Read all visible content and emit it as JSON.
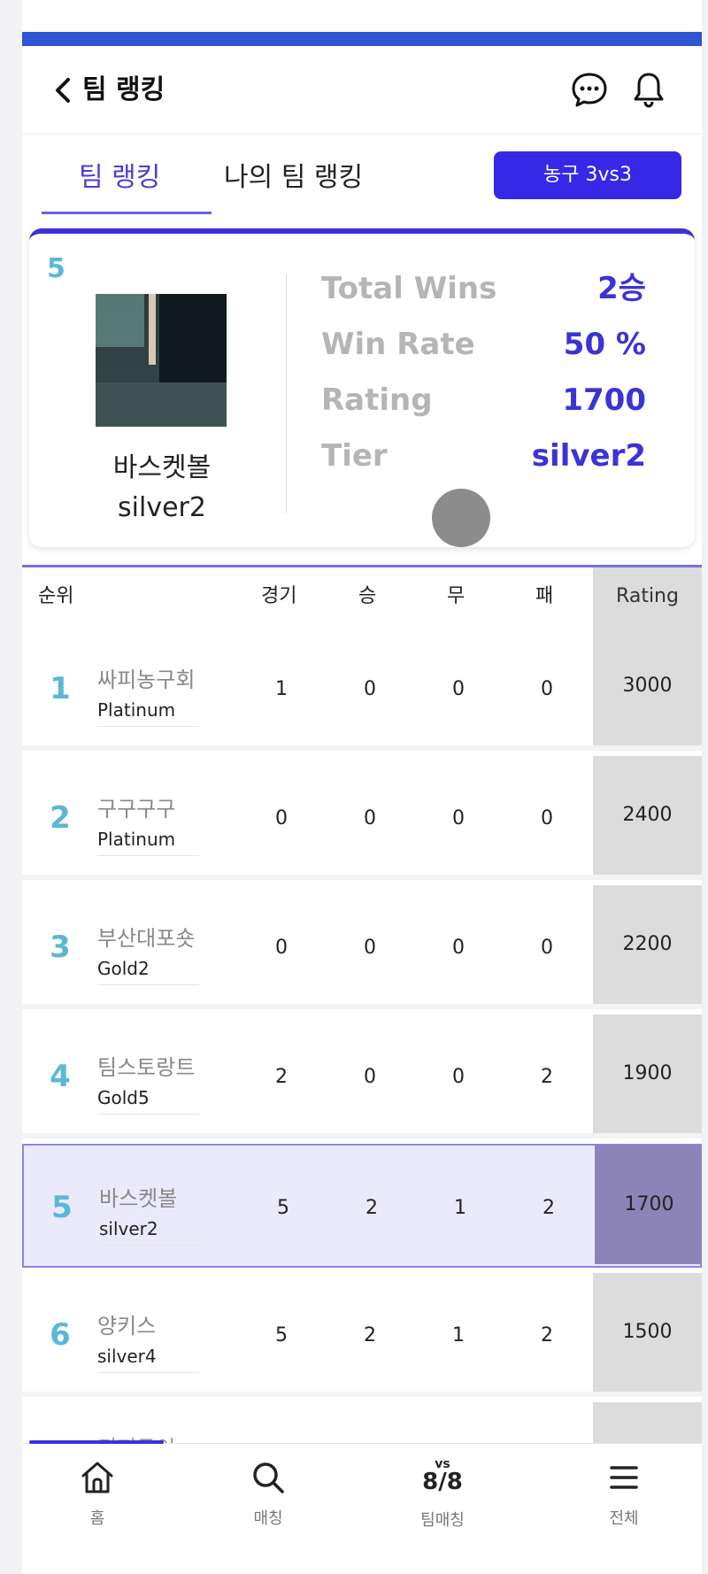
{
  "header": {
    "title": "팀 랭킹"
  },
  "tabs": [
    {
      "label": "팀 랭킹"
    },
    {
      "label": "나의 팀 랭킹"
    }
  ],
  "sport_button": "농구 3vs3",
  "my_team": {
    "rank": "5",
    "name": "바스켓볼",
    "tier": "silver2",
    "stats": [
      {
        "label": "Total Wins",
        "value": "2승"
      },
      {
        "label": "Win Rate",
        "value": "50 %"
      },
      {
        "label": "Rating",
        "value": "1700"
      },
      {
        "label": "Tier",
        "value": "silver2"
      }
    ]
  },
  "table": {
    "headers": {
      "rank": "순위",
      "games": "경기",
      "wins": "승",
      "draws": "무",
      "losses": "패",
      "rating": "Rating"
    },
    "rows": [
      {
        "rank": "1",
        "name": "싸피농구회",
        "tier": "Platinum",
        "games": "1",
        "wins": "0",
        "draws": "0",
        "losses": "0",
        "rating": "3000"
      },
      {
        "rank": "2",
        "name": "구구구구",
        "tier": "Platinum",
        "games": "0",
        "wins": "0",
        "draws": "0",
        "losses": "0",
        "rating": "2400"
      },
      {
        "rank": "3",
        "name": "부산대포숏",
        "tier": "Gold2",
        "games": "0",
        "wins": "0",
        "draws": "0",
        "losses": "0",
        "rating": "2200"
      },
      {
        "rank": "4",
        "name": "팀스토랑트",
        "tier": "Gold5",
        "games": "2",
        "wins": "0",
        "draws": "0",
        "losses": "2",
        "rating": "1900"
      },
      {
        "rank": "5",
        "name": "바스켓볼",
        "tier": "silver2",
        "games": "5",
        "wins": "2",
        "draws": "1",
        "losses": "2",
        "rating": "1700"
      },
      {
        "rank": "6",
        "name": "양키스",
        "tier": "silver4",
        "games": "5",
        "wins": "2",
        "draws": "1",
        "losses": "2",
        "rating": "1500"
      }
    ],
    "peek_row_name": "티지두이"
  },
  "bottom_nav": [
    {
      "label": "홈",
      "icon": "home-icon"
    },
    {
      "label": "매칭",
      "icon": "search-icon"
    },
    {
      "label": "팀매칭",
      "icon": "vs-icon",
      "icon_top": "vs",
      "icon_bottom": "8/8"
    },
    {
      "label": "전체",
      "icon": "menu-icon"
    }
  ],
  "colors": {
    "accent": "#3727e6",
    "rank_blue": "#5ab8d6",
    "top_bar": "#2f55d4"
  }
}
